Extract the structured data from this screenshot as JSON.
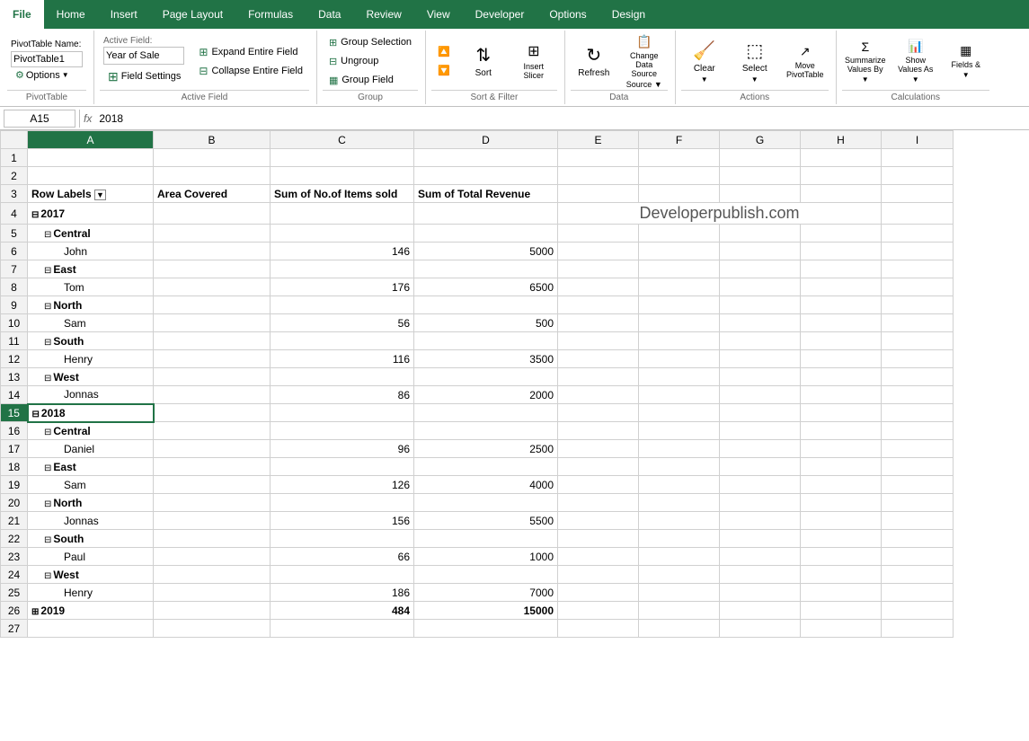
{
  "tabs": {
    "file": "File",
    "home": "Home",
    "insert": "Insert",
    "page_layout": "Page Layout",
    "formulas": "Formulas",
    "data": "Data",
    "review": "Review",
    "view": "View",
    "developer": "Developer",
    "options": "Options",
    "design": "Design",
    "active": "Design"
  },
  "ribbon": {
    "pivot_table_group": "PivotTable",
    "active_field_group": "Active Field",
    "group_group": "Group",
    "sort_filter_group": "Sort & Filter",
    "data_group": "Data",
    "actions_group": "Actions",
    "calculations_group": "Calculations",
    "pivot_name_label": "PivotTable Name:",
    "pivot_name_value": "PivotTable1",
    "active_field_label": "Active Field:",
    "active_field_value": "Year of Sale",
    "options_btn": "Options",
    "field_settings_btn": "Field Settings",
    "expand_entire_field": "Expand Entire Field",
    "collapse_entire_field": "Collapse Entire Field",
    "group_selection": "Group Selection",
    "ungroup": "Ungroup",
    "group_field": "Group Field",
    "sort_asc": "",
    "sort_desc": "",
    "sort_btn": "Sort",
    "insert_slicer": "Insert Slicer",
    "refresh_btn": "Refresh",
    "change_data_source": "Change Data Source",
    "clear_btn": "Clear",
    "select_btn": "Select",
    "move_pivot": "Move PivotTable",
    "summarize_values_by": "Summarize Values By",
    "show_values_as": "Show Values As",
    "fields_items": "Fields &"
  },
  "formula_bar": {
    "name_box": "A15",
    "fx": "fx",
    "formula": "2018"
  },
  "columns": {
    "headers": [
      "A",
      "B",
      "C",
      "D",
      "E",
      "F",
      "G",
      "H",
      "I"
    ]
  },
  "watermark": "Developerpublish.com",
  "pivot_headers": {
    "row_labels": "Row Labels",
    "area_covered": "Area Covered",
    "sum_items": "Sum of No.of Items sold",
    "sum_revenue": "Sum of Total Revenue"
  },
  "rows": [
    {
      "row": 1,
      "type": "empty"
    },
    {
      "row": 2,
      "type": "empty"
    },
    {
      "row": 3,
      "type": "header"
    },
    {
      "row": 4,
      "type": "year",
      "label": "2017",
      "expanded": true
    },
    {
      "row": 5,
      "type": "region",
      "region": "Central",
      "expanded": true
    },
    {
      "row": 6,
      "type": "person",
      "name": "John",
      "items": "146",
      "revenue": "5000"
    },
    {
      "row": 7,
      "type": "region",
      "region": "East",
      "expanded": true
    },
    {
      "row": 8,
      "type": "person",
      "name": "Tom",
      "items": "176",
      "revenue": "6500"
    },
    {
      "row": 9,
      "type": "region",
      "region": "North",
      "expanded": true
    },
    {
      "row": 10,
      "type": "person",
      "name": "Sam",
      "items": "56",
      "revenue": "500"
    },
    {
      "row": 11,
      "type": "region",
      "region": "South",
      "expanded": true
    },
    {
      "row": 12,
      "type": "person",
      "name": "Henry",
      "items": "116",
      "revenue": "3500"
    },
    {
      "row": 13,
      "type": "region",
      "region": "West",
      "expanded": true
    },
    {
      "row": 14,
      "type": "person",
      "name": "Jonnas",
      "items": "86",
      "revenue": "2000"
    },
    {
      "row": 15,
      "type": "year",
      "label": "2018",
      "expanded": true,
      "selected": true
    },
    {
      "row": 16,
      "type": "region",
      "region": "Central",
      "expanded": true
    },
    {
      "row": 17,
      "type": "person",
      "name": "Daniel",
      "items": "96",
      "revenue": "2500"
    },
    {
      "row": 18,
      "type": "region",
      "region": "East",
      "expanded": true
    },
    {
      "row": 19,
      "type": "person",
      "name": "Sam",
      "items": "126",
      "revenue": "4000"
    },
    {
      "row": 20,
      "type": "region",
      "region": "North",
      "expanded": true
    },
    {
      "row": 21,
      "type": "person",
      "name": "Jonnas",
      "items": "156",
      "revenue": "5500"
    },
    {
      "row": 22,
      "type": "region",
      "region": "South",
      "expanded": true
    },
    {
      "row": 23,
      "type": "person",
      "name": "Paul",
      "items": "66",
      "revenue": "1000"
    },
    {
      "row": 24,
      "type": "region",
      "region": "West",
      "expanded": true
    },
    {
      "row": 25,
      "type": "person",
      "name": "Henry",
      "items": "186",
      "revenue": "7000"
    },
    {
      "row": 26,
      "type": "year_total",
      "label": "2019",
      "items": "484",
      "revenue": "15000",
      "expanded": false
    },
    {
      "row": 27,
      "type": "empty"
    }
  ]
}
